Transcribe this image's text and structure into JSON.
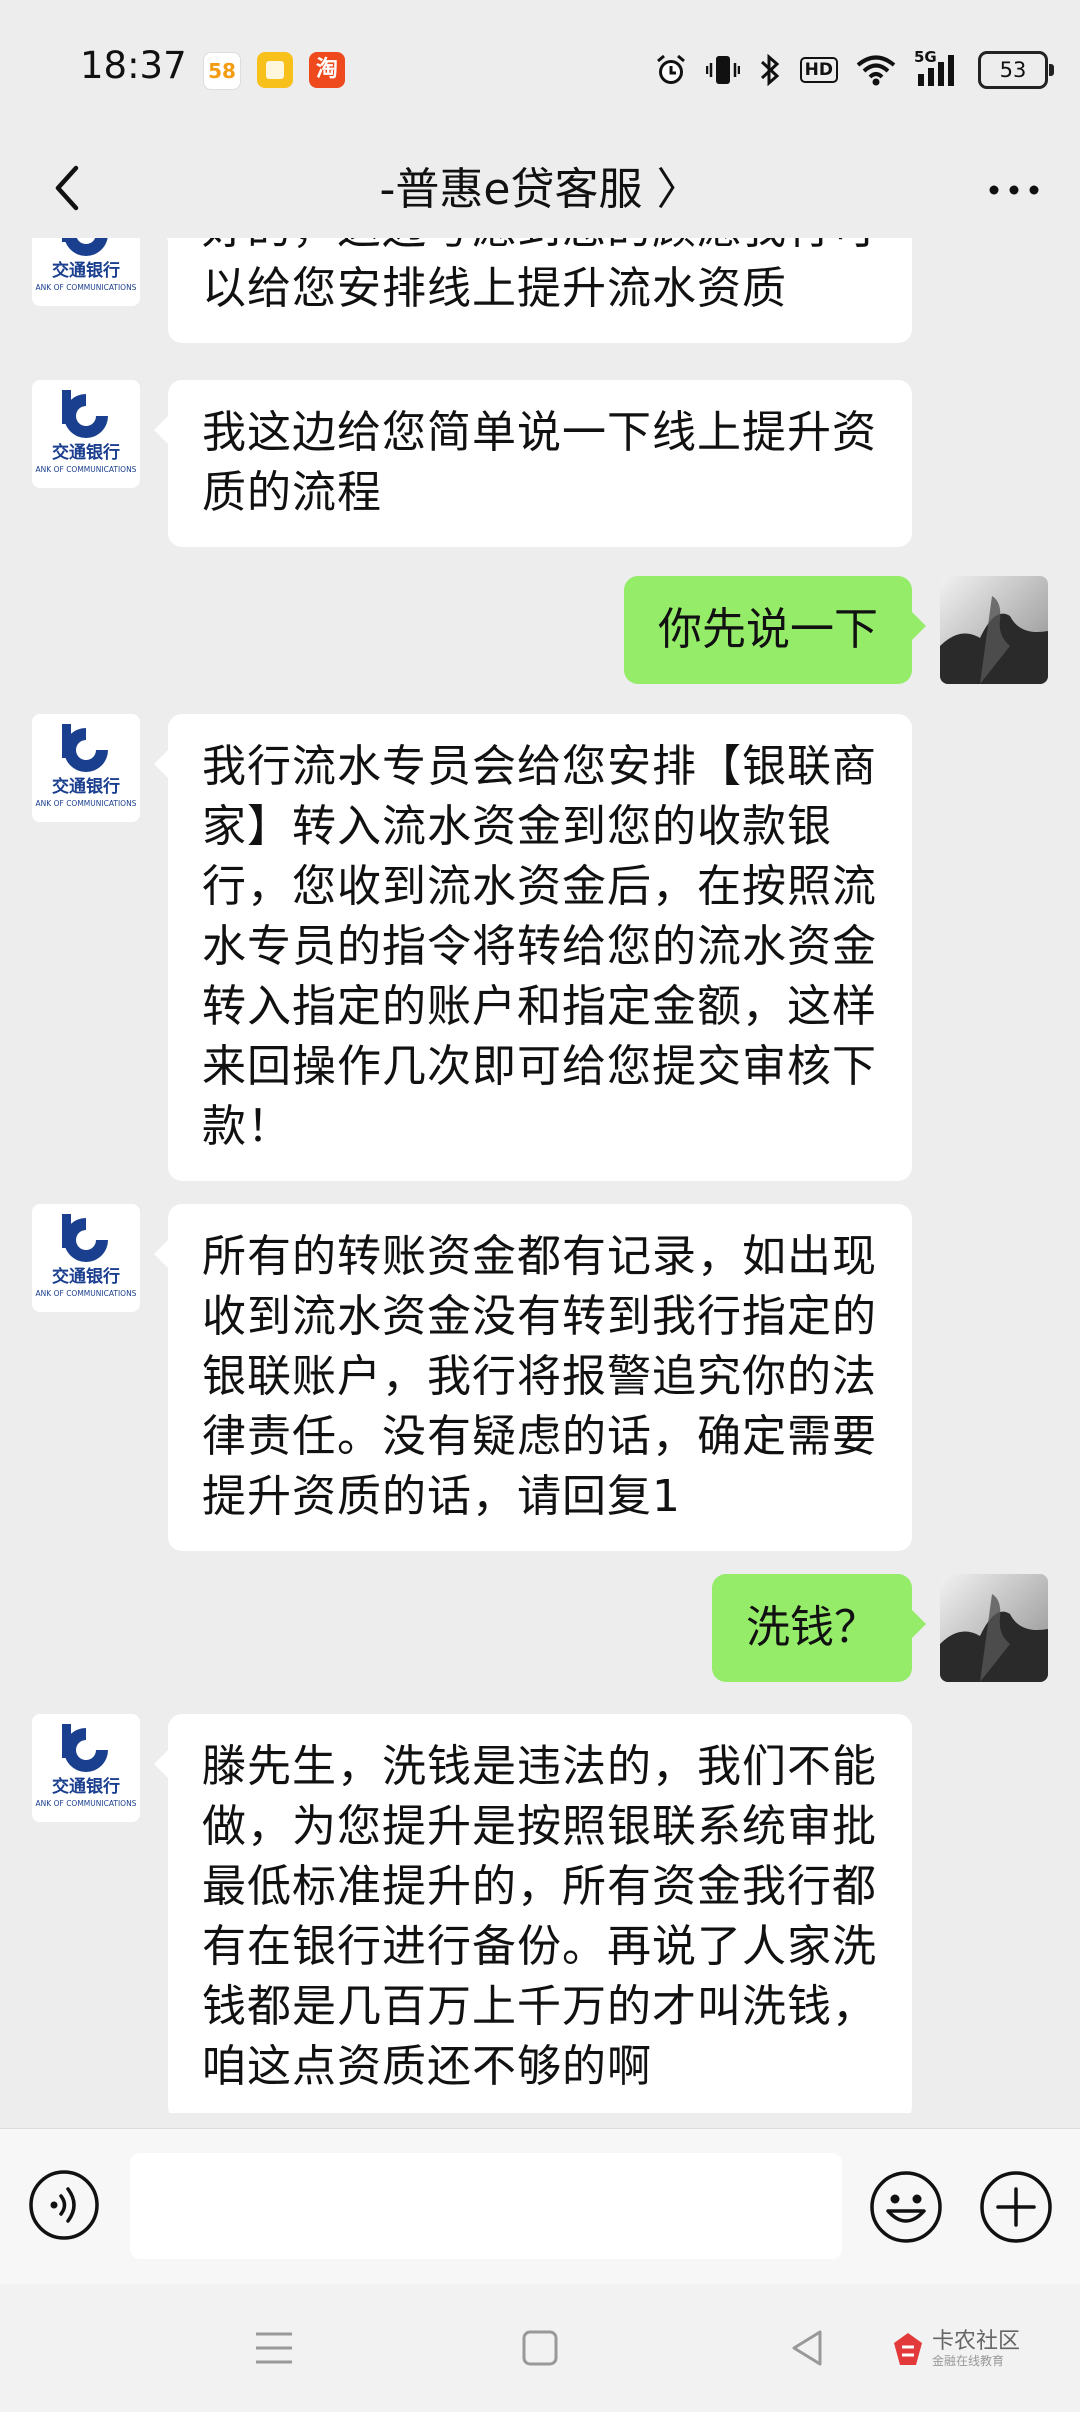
{
  "status_bar": {
    "time": "18:37",
    "apps": [
      {
        "name": "58-app-icon",
        "label": "58",
        "color": "#f6b81c"
      },
      {
        "name": "notes-app-icon",
        "label": "",
        "color": "#f7c01b"
      },
      {
        "name": "taobao-app-icon",
        "label": "淘",
        "color": "#ee4a1e"
      }
    ],
    "network": "5G",
    "battery": "53"
  },
  "header": {
    "title": "-普惠e贷客服 〉"
  },
  "messages": [
    {
      "side": "in",
      "text": "好的，这边考虑到您的顾虑我行可以给您安排线上提升流水资质"
    },
    {
      "side": "in",
      "text": "我这边给您简单说一下线上提升资质的流程"
    },
    {
      "side": "out",
      "text": "你先说一下"
    },
    {
      "side": "in",
      "text": "我行流水专员会给您安排【银联商家】转入流水资金到您的收款银行，您收到流水资金后，在按照流水专员的指令将转给您的流水资金转入指定的账户和指定金额，这样来回操作几次即可给您提交审核下款！"
    },
    {
      "side": "in",
      "text": "所有的转账资金都有记录，如出现收到流水资金没有转到我行指定的银联账户，我行将报警追究你的法律责任。没有疑虑的话，确定需要提升资质的话，请回复1"
    },
    {
      "side": "out",
      "text": "洗钱？"
    },
    {
      "side": "in",
      "text": "滕先生，洗钱是违法的，我们不能做，为您提升是按照银联系统审批最低标准提升的，所有资金我行都有在银行进行备份。再说了人家洗钱都是几百万上千万的才叫洗钱，咱这点资质还不够的啊"
    }
  ],
  "bank_avatar": {
    "name_cn": "交通银行",
    "name_en": "ANK OF COMMUNICATIONS",
    "color": "#1b3f8f"
  },
  "input": {
    "value": "",
    "placeholder": ""
  },
  "watermark": {
    "line1": "卡农社区",
    "line2": "金融在线教育"
  }
}
